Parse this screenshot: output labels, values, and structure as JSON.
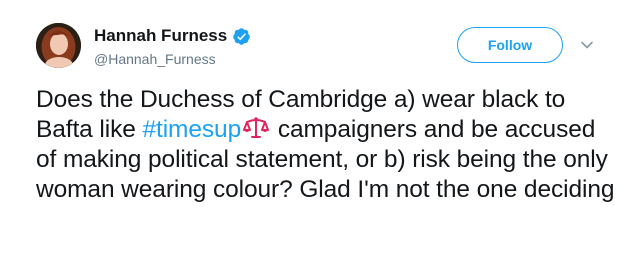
{
  "tweet": {
    "display_name": "Hannah Furness",
    "handle": "@Hannah_Furness",
    "verified_icon": "verified-badge-icon",
    "follow_label": "Follow",
    "more_icon": "chevron-down-icon",
    "text_parts": {
      "before_hashtag": "Does the Duchess of Cambridge a) wear black to Bafta like ",
      "hashtag": "#timesup",
      "emoji": "scales-of-justice-icon",
      "after_hashtag": " campaigners and be accused of making political statement, or b) risk being the only woman wearing colour? Glad I'm not the one deciding"
    }
  },
  "colors": {
    "accent": "#1da1f2",
    "text": "#14171a",
    "muted": "#657786",
    "emoji": "#e0245e"
  }
}
